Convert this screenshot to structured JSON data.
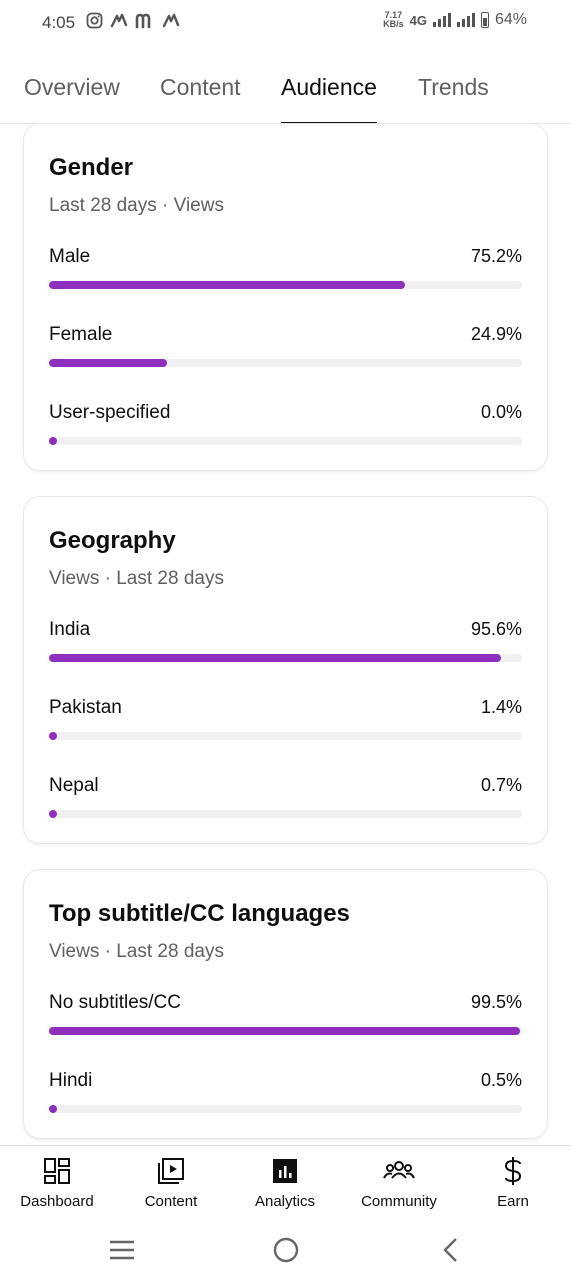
{
  "status_bar": {
    "time": "4:05",
    "left_icons": [
      "instagram-icon",
      "app-icon",
      "m-icon",
      "app-icon"
    ],
    "net_speed_value": "7.17",
    "net_speed_unit": "KB/s",
    "network": "4G",
    "battery": "64%"
  },
  "tabs": [
    {
      "label": "Overview",
      "active": false
    },
    {
      "label": "Content",
      "active": false
    },
    {
      "label": "Audience",
      "active": true
    },
    {
      "label": "Trends",
      "active": false
    }
  ],
  "cards": [
    {
      "title": "Gender",
      "subtitle": "Last 28 days · Views",
      "rows": [
        {
          "label": "Male",
          "value": "75.2%",
          "fraction": 0.752
        },
        {
          "label": "Female",
          "value": "24.9%",
          "fraction": 0.249
        },
        {
          "label": "User-specified",
          "value": "0.0%",
          "fraction": 0.0
        }
      ]
    },
    {
      "title": "Geography",
      "subtitle": "Views · Last 28 days",
      "rows": [
        {
          "label": "India",
          "value": "95.6%",
          "fraction": 0.956
        },
        {
          "label": "Pakistan",
          "value": "1.4%",
          "fraction": 0.014
        },
        {
          "label": "Nepal",
          "value": "0.7%",
          "fraction": 0.007
        }
      ]
    },
    {
      "title": "Top subtitle/CC languages",
      "subtitle": "Views · Last 28 days",
      "rows": [
        {
          "label": "No subtitles/CC",
          "value": "99.5%",
          "fraction": 0.995
        },
        {
          "label": "Hindi",
          "value": "0.5%",
          "fraction": 0.005
        }
      ]
    }
  ],
  "bottom_nav": [
    {
      "label": "Dashboard",
      "icon": "dashboard-icon"
    },
    {
      "label": "Content",
      "icon": "content-icon"
    },
    {
      "label": "Analytics",
      "icon": "analytics-icon",
      "active": true
    },
    {
      "label": "Community",
      "icon": "community-icon"
    },
    {
      "label": "Earn",
      "icon": "dollar-icon"
    }
  ],
  "system_nav": [
    "menu-icon",
    "home-icon",
    "back-icon"
  ],
  "colors": {
    "accent_bar": "#8e2fbe",
    "track": "#f0f0f0",
    "text_primary": "#0f0f0f",
    "text_secondary": "#606060"
  }
}
